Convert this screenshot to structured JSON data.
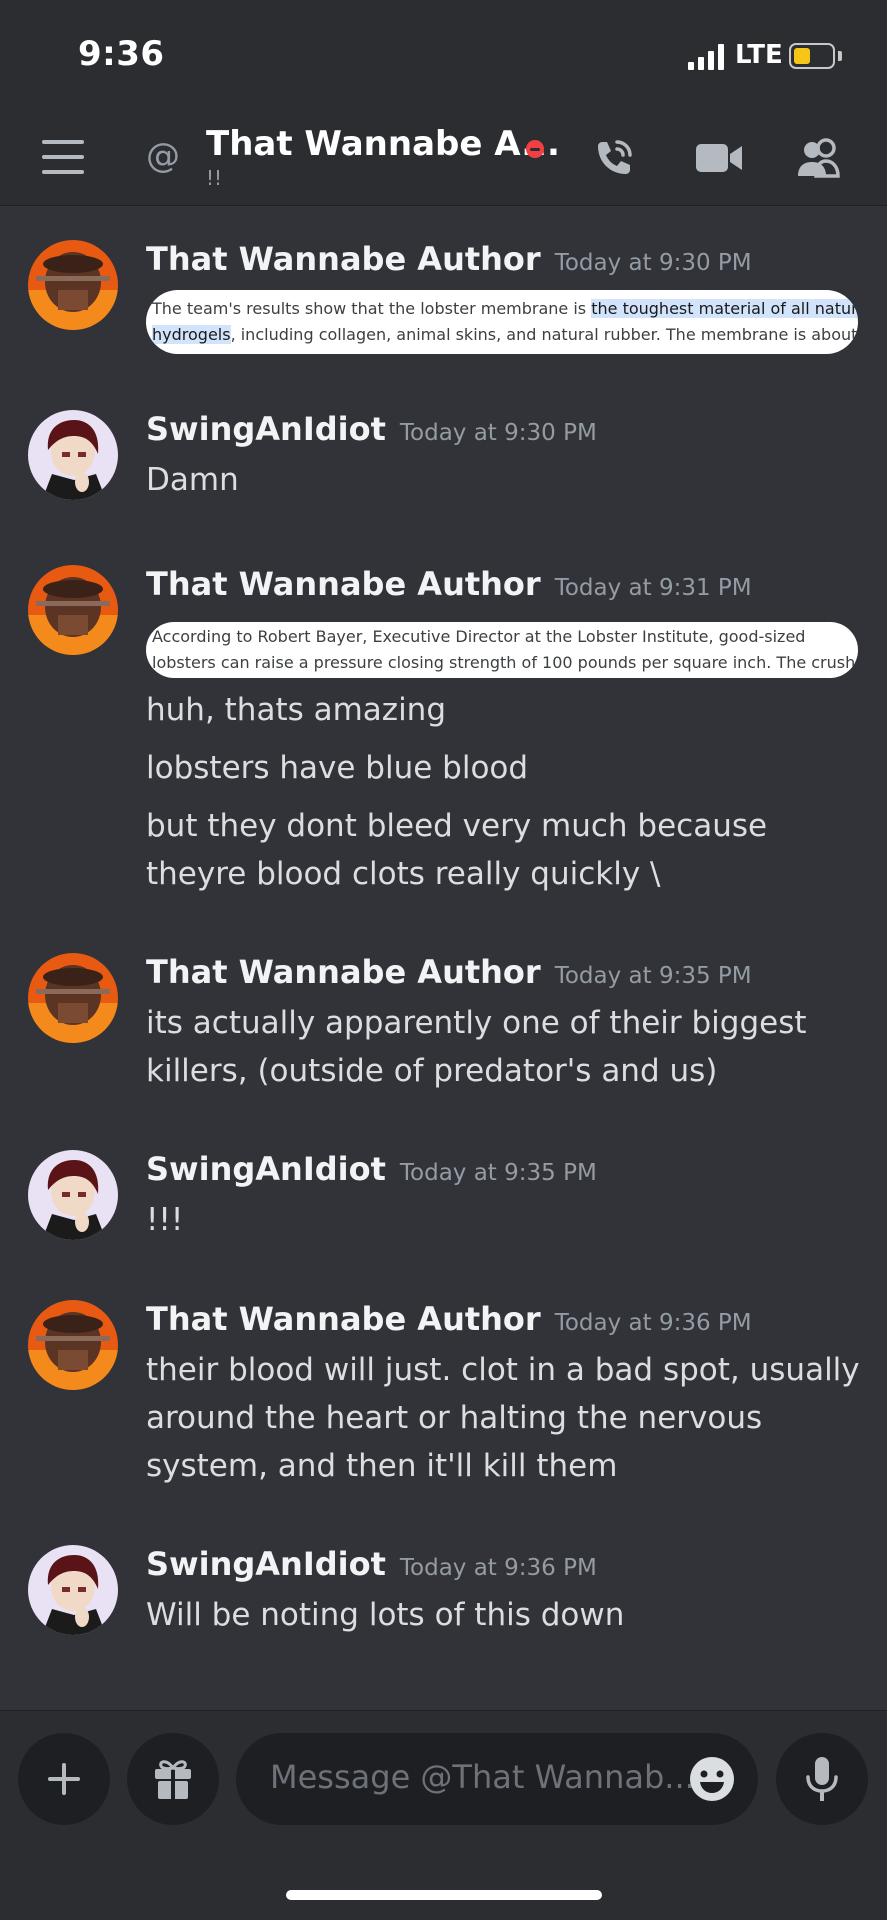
{
  "status_bar": {
    "time": "9:36",
    "network": "LTE"
  },
  "header": {
    "channel_name": "That Wannabe A...",
    "channel_status": "!!"
  },
  "messages": [
    {
      "author": "That Wannabe Author",
      "time": "Today at 9:30 PM",
      "image_lines": [
        {
          "plain": "The team's results show that the lobster membrane is ",
          "highlight": "the toughest material of all natural"
        },
        {
          "highlight": "hydrogels",
          "plain": ", including collagen, animal skins, and natural rubber. The membrane is about as"
        }
      ]
    },
    {
      "author": "SwingAnIdiot",
      "time": "Today at 9:30 PM",
      "lines": [
        "Damn"
      ]
    },
    {
      "author": "That Wannabe Author",
      "time": "Today at 9:31 PM",
      "image_lines": [
        {
          "plain": "According to Robert Bayer, Executive Director at the Lobster Institute, good-sized"
        },
        {
          "plain": "lobsters can raise a pressure closing strength of 100 pounds per square inch. The crusher"
        }
      ],
      "paragraphs": [
        [
          "huh, thats amazing"
        ],
        [
          "lobsters have blue blood"
        ],
        [
          "but they dont bleed very much because",
          "theyre blood clots really quickly \\"
        ]
      ]
    },
    {
      "author": "That Wannabe Author",
      "time": "Today at 9:35 PM",
      "lines": [
        "its actually apparently one of their biggest",
        "killers, (outside of predator's and us)"
      ]
    },
    {
      "author": "SwingAnIdiot",
      "time": "Today at 9:35 PM",
      "lines": [
        "!!!"
      ]
    },
    {
      "author": "That Wannabe Author",
      "time": "Today at 9:36 PM",
      "lines": [
        "their blood will just. clot in a bad spot, usually",
        "around the heart or halting the nervous",
        "system, and then it'll kill them"
      ]
    },
    {
      "author": "SwingAnIdiot",
      "time": "Today at 9:36 PM",
      "lines": [
        "Will be noting lots of this down"
      ]
    }
  ],
  "input": {
    "placeholder": "Message @That Wannab..."
  },
  "colors": {
    "background": "#313338",
    "header_background": "#2b2d31",
    "input_background": "#1e1f22",
    "dnd_red": "#f23f43",
    "battery_yellow": "#f5c518",
    "highlight": "#d2e3fc"
  },
  "icons": {
    "menu": "hamburger-menu-icon",
    "dm": "at-sign-icon",
    "status": "do-not-disturb-icon",
    "call": "phone-call-icon",
    "video": "video-camera-icon",
    "members": "members-icon",
    "add": "plus-icon",
    "gift": "gift-icon",
    "emoji": "emoji-icon",
    "voice": "microphone-icon"
  },
  "battery_level": 0.45
}
